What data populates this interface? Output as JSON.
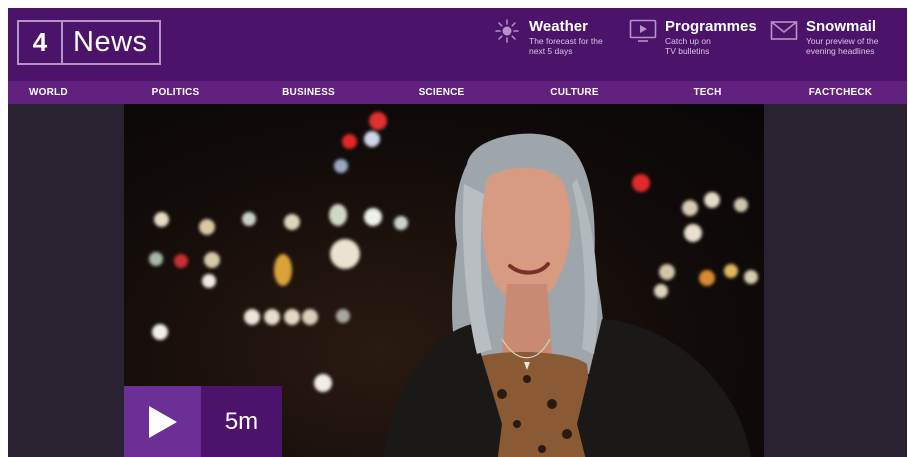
{
  "header": {
    "logo_number": "4",
    "logo_text": "News",
    "promos": [
      {
        "icon": "sun-icon",
        "title": "Weather",
        "desc_line1": "The forecast for the",
        "desc_line2": "next 5 days"
      },
      {
        "icon": "tv-play-icon",
        "title": "Programmes",
        "desc_line1": "Catch up on",
        "desc_line2": "TV bulletins"
      },
      {
        "icon": "envelope-icon",
        "title": "Snowmail",
        "desc_line1": "Your preview of the",
        "desc_line2": "evening headlines"
      }
    ]
  },
  "nav": {
    "items": [
      "WORLD",
      "POLITICS",
      "BUSINESS",
      "SCIENCE",
      "CULTURE",
      "TECH",
      "FACTCHECK"
    ]
  },
  "video": {
    "duration": "5m"
  },
  "colors": {
    "header_bg": "#4b1369",
    "nav_bg": "#62207f",
    "play_bg": "#6b2f96"
  }
}
